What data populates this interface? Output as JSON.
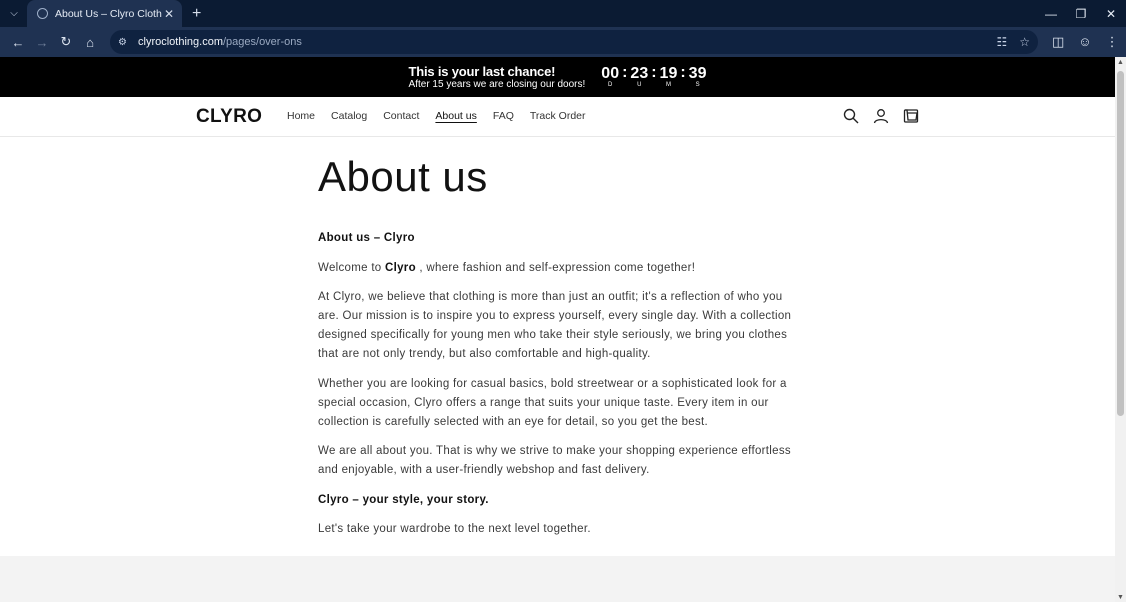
{
  "browser": {
    "tab_title": "About Us – Clyro Clothing",
    "url_host": "clyroclothing.com",
    "url_path": "/pages/over-ons"
  },
  "announcement": {
    "headline": "This is your last chance!",
    "subline": "After 15 years we are closing our doors!",
    "countdown": [
      {
        "value": "00",
        "label": "D"
      },
      {
        "value": "23",
        "label": "U"
      },
      {
        "value": "19",
        "label": "M"
      },
      {
        "value": "39",
        "label": "S"
      }
    ]
  },
  "header": {
    "logo": "CLYRO",
    "nav": [
      "Home",
      "Catalog",
      "Contact",
      "About us",
      "FAQ",
      "Track Order"
    ],
    "active_nav": "About us"
  },
  "content": {
    "title": "About us",
    "subtitle": "About us – Clyro",
    "welcome_prefix": "Welcome to ",
    "welcome_brand": "Clyro",
    "welcome_suffix": " , where fashion and self-expression come together!",
    "p1": "At Clyro, we believe that clothing is more than just an outfit; it's a reflection of who you are. Our mission is to inspire you to express yourself, every single day. With a collection designed specifically for young men who take their style seriously, we bring you clothes that are not only trendy, but also comfortable and high-quality.",
    "p2": "Whether you are looking for casual basics, bold streetwear or a sophisticated look for a special occasion, Clyro offers a range that suits your unique taste. Every item in our collection is carefully selected with an eye for detail, so you get the best.",
    "p3": "We are all about you. That is why we strive to make your shopping experience effortless and enjoyable, with a user-friendly webshop and fast delivery.",
    "tagline": "Clyro – your style, your story.",
    "closing": "Let's take your wardrobe to the next level together."
  }
}
